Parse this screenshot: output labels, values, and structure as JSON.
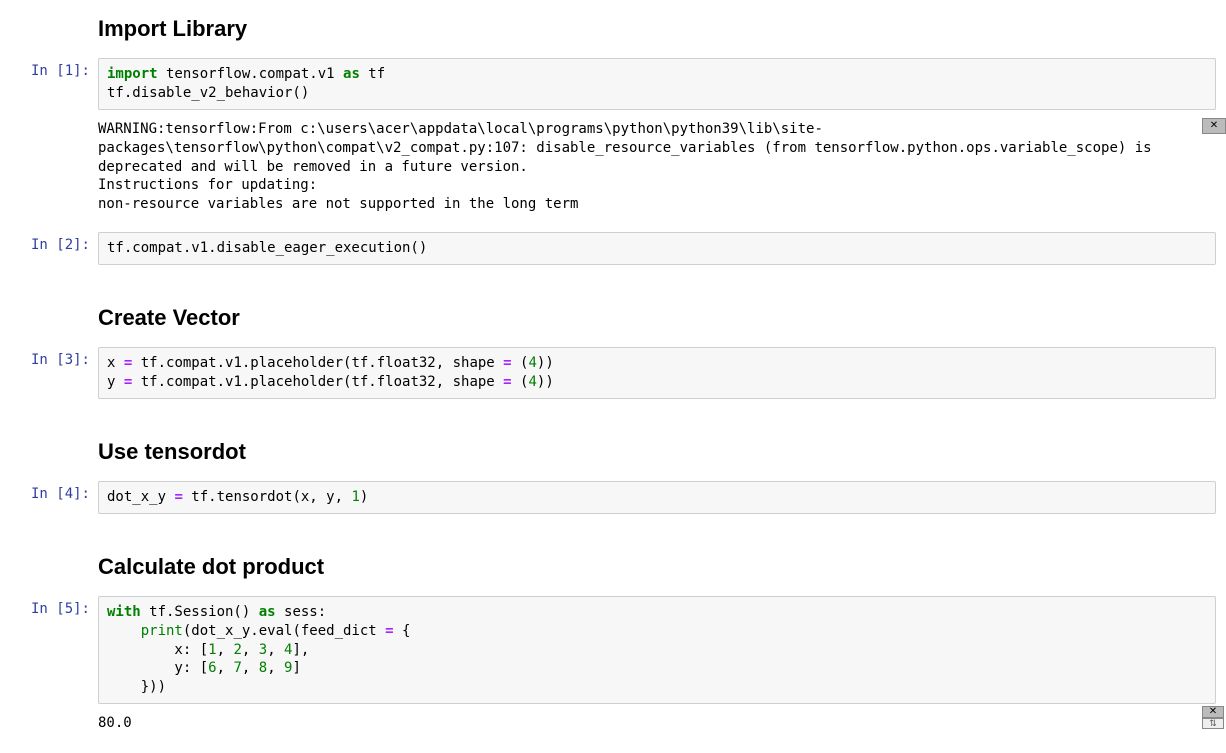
{
  "headings": {
    "h1": "Import Library",
    "h2": "Create Vector",
    "h3": "Use tensordot",
    "h4": "Calculate dot product"
  },
  "prompts": {
    "c1": "In [1]:",
    "c2": "In [2]:",
    "c3": "In [3]:",
    "c4": "In [4]:",
    "c5": "In [5]:"
  },
  "code": {
    "c1": {
      "kw_import": "import",
      "mod": " tensorflow.compat.v1 ",
      "kw_as": "as",
      "alias": " tf",
      "line2": "tf.disable_v2_behavior()"
    },
    "c2": {
      "line1": "tf.compat.v1.disable_eager_execution()"
    },
    "c3": {
      "lhs1": "x ",
      "eq": "=",
      "rhs1a": " tf.compat.v1.placeholder(tf.float32, shape ",
      "rhs1b": " (",
      "num4": "4",
      "rhs1c": "))",
      "lhs2": "y ",
      "rhs2a": " tf.compat.v1.placeholder(tf.float32, shape ",
      "rhs2b": " (",
      "rhs2c": "))"
    },
    "c4": {
      "lhs": "dot_x_y ",
      "eq": "=",
      "rhs_a": " tf.tensordot(x, y, ",
      "num1": "1",
      "rhs_b": ")"
    },
    "c5": {
      "kw_with": "with",
      "sess_a": " tf.Session() ",
      "kw_as": "as",
      "sess_b": " sess:",
      "indent1": "    ",
      "print_call": "print",
      "print_args_a": "(dot_x_y.eval(feed_dict ",
      "eq": "=",
      "print_args_b": " {",
      "indent2": "        x: [",
      "n1": "1",
      "sep": ", ",
      "n2": "2",
      "n3": "3",
      "n4": "4",
      "close_list1": "],",
      "indent3": "        y: [",
      "n6": "6",
      "n7": "7",
      "n8": "8",
      "n9": "9",
      "close_list2": "]",
      "indent4": "    }))"
    }
  },
  "outputs": {
    "o1": "WARNING:tensorflow:From c:\\users\\acer\\appdata\\local\\programs\\python\\python39\\lib\\site-packages\\tensorflow\\python\\compat\\v2_compat.py:107: disable_resource_variables (from tensorflow.python.ops.variable_scope) is deprecated and will be removed in a future version.\nInstructions for updating:\nnon-resource variables are not supported in the long term",
    "o5": "80.0"
  }
}
